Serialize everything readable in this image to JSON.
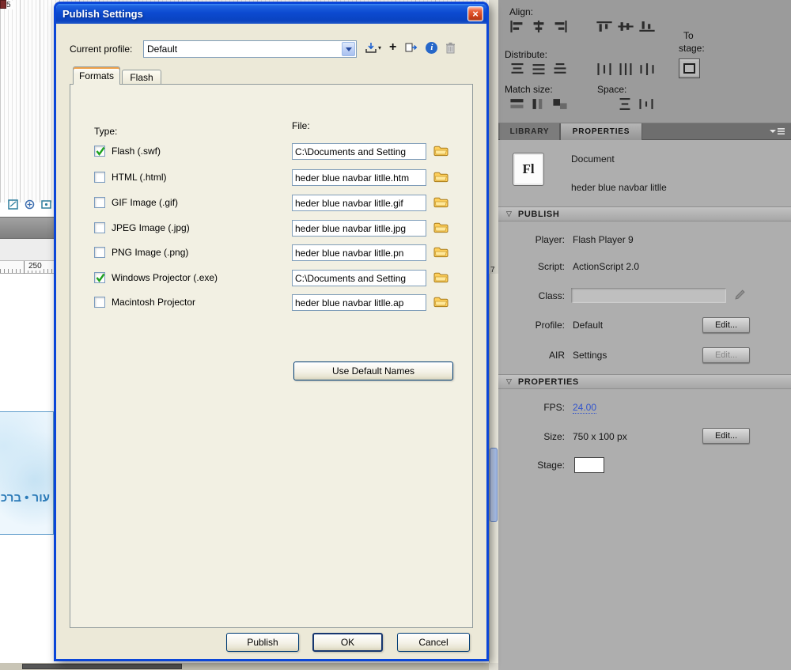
{
  "icons": {
    "close": "×",
    "plus": "+",
    "info": "i",
    "caret": "▾",
    "section": "▽"
  },
  "stage": {
    "frame_number": "5",
    "ruler_left": "250",
    "ruler_right_digit": "7",
    "canvas_text": "עור • ברכ"
  },
  "dialog": {
    "title": "Publish Settings",
    "profile_label": "Current profile:",
    "profile_value": "Default",
    "tabs": {
      "formats": "Formats",
      "flash": "Flash"
    },
    "type_header": "Type:",
    "file_header": "File:",
    "rows": [
      {
        "label": "Flash (.swf)",
        "checked": true,
        "file": "C:\\Documents and Setting"
      },
      {
        "label": "HTML (.html)",
        "checked": false,
        "file": "heder blue navbar litlle.htm"
      },
      {
        "label": "GIF Image (.gif)",
        "checked": false,
        "file": "heder blue navbar litlle.gif"
      },
      {
        "label": "JPEG Image (.jpg)",
        "checked": false,
        "file": "heder blue navbar litlle.jpg"
      },
      {
        "label": "PNG Image (.png)",
        "checked": false,
        "file": "heder blue navbar litlle.pn"
      },
      {
        "label": "Windows Projector (.exe)",
        "checked": true,
        "file": "C:\\Documents and Setting"
      },
      {
        "label": "Macintosh Projector",
        "checked": false,
        "file": "heder blue navbar litlle.ap"
      }
    ],
    "use_default_names": "Use Default Names",
    "publish": "Publish",
    "ok": "OK",
    "cancel": "Cancel"
  },
  "align_panel": {
    "align_label": "Align:",
    "distribute_label": "Distribute:",
    "match_label": "Match size:",
    "space_label": "Space:",
    "to": "To",
    "stage": "stage:"
  },
  "panel_tabs": {
    "library": "LIBRARY",
    "properties": "PROPERTIES"
  },
  "props": {
    "doc_icon": "Fl",
    "doc_type": "Document",
    "doc_name": "heder blue navbar litlle",
    "publish_header": "PUBLISH",
    "player_label": "Player:",
    "player_value": "Flash Player 9",
    "script_label": "Script:",
    "script_value": "ActionScript 2.0",
    "class_label": "Class:",
    "profile_label": "Profile:",
    "profile_value": "Default",
    "profile_edit": "Edit...",
    "air_label": "AIR",
    "air_value": "Settings",
    "air_edit": "Edit...",
    "properties_header": "PROPERTIES",
    "fps_label": "FPS:",
    "fps_value": "24.00",
    "size_label": "Size:",
    "size_value": "750 x 100 px",
    "size_edit": "Edit...",
    "stage_label": "Stage:"
  }
}
